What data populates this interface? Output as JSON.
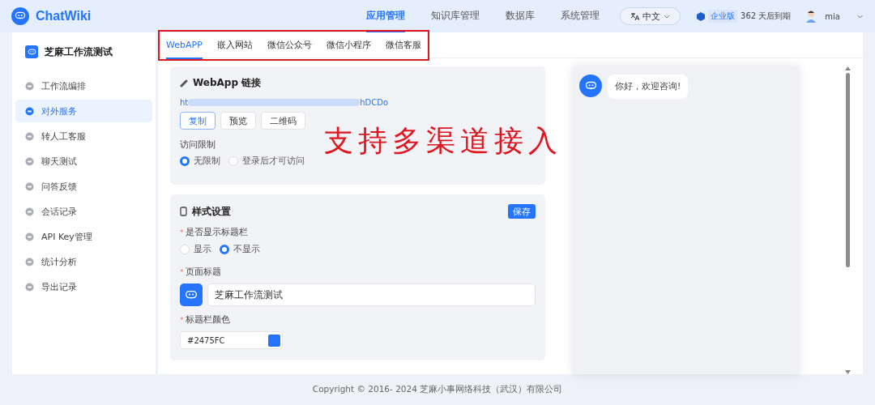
{
  "header": {
    "logo": "ChatWiki",
    "nav": [
      {
        "label": "应用管理",
        "selected": true
      },
      {
        "label": "知识库管理",
        "selected": false
      },
      {
        "label": "数据库",
        "selected": false
      },
      {
        "label": "系统管理",
        "selected": false
      }
    ],
    "language": "中文",
    "edition": "企业版",
    "expiry": "362 天后到期",
    "user": "mia"
  },
  "sidebar": {
    "app_name": "芝麻工作流测试",
    "items": [
      {
        "label": "工作流编排",
        "selected": false
      },
      {
        "label": "对外服务",
        "selected": true
      },
      {
        "label": "转人工客服",
        "selected": false
      },
      {
        "label": "聊天测试",
        "selected": false
      },
      {
        "label": "问答反馈",
        "selected": false
      },
      {
        "label": "会话记录",
        "selected": false
      },
      {
        "label": "API Key管理",
        "selected": false
      },
      {
        "label": "统计分析",
        "selected": false
      },
      {
        "label": "导出记录",
        "selected": false
      }
    ]
  },
  "tabs": [
    {
      "label": "WebAPP",
      "selected": true
    },
    {
      "label": "嵌入网站",
      "selected": false
    },
    {
      "label": "微信公众号",
      "selected": false
    },
    {
      "label": "微信小程序",
      "selected": false
    },
    {
      "label": "微信客服",
      "selected": false
    }
  ],
  "link_card": {
    "title": "WebApp 链接",
    "url_start": "ht",
    "url_end": "hDCDo",
    "buttons": [
      {
        "label": "复制",
        "selected": true
      },
      {
        "label": "预览",
        "selected": false
      },
      {
        "label": "二维码",
        "selected": false
      }
    ],
    "access_label": "访问限制",
    "access_options": [
      {
        "label": "无限制",
        "selected": true
      },
      {
        "label": "登录后才可访问",
        "selected": false
      }
    ]
  },
  "annotation": "支持多渠道接入",
  "style_card": {
    "title": "样式设置",
    "save": "保存",
    "show_title_mark": "*",
    "show_title_label": "是否显示标题栏",
    "show_title_options": [
      {
        "label": "显示",
        "selected": false
      },
      {
        "label": "不显示",
        "selected": true
      }
    ],
    "page_title_mark": "*",
    "page_title_label": "页面标题",
    "page_title": "芝麻工作流测试",
    "title_color_mark": "*",
    "title_color_label": "标题栏颜色",
    "title_color": "#2475FC"
  },
  "preview": {
    "greeting": "你好，欢迎咨询!"
  },
  "footer": "Copyright © 2016- 2024 芝麻小事网络科技（武汉）有限公司"
}
